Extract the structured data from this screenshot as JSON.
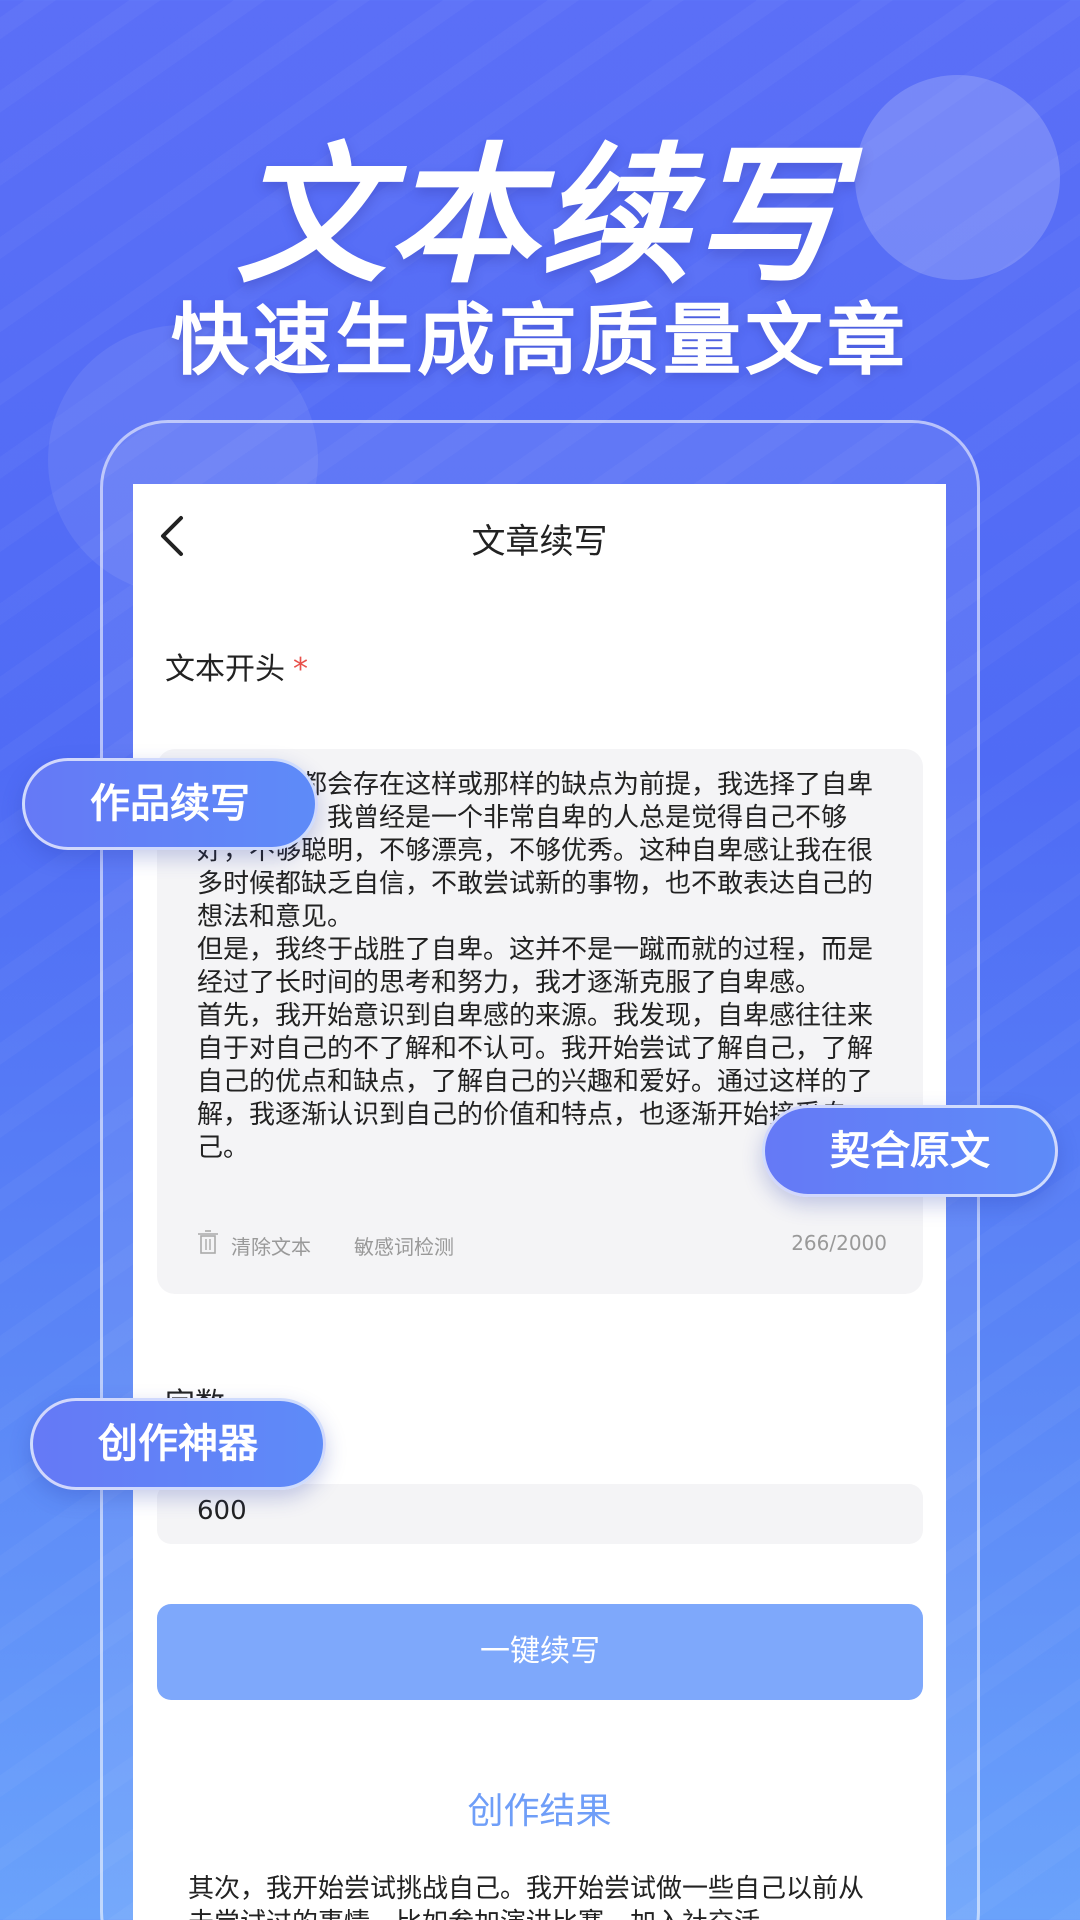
{
  "hero": {
    "title": "文本续写",
    "subtitle": "快速生成高质量文章"
  },
  "nav": {
    "title": "文章续写",
    "back_icon": "chevron-left-icon"
  },
  "text_beginning": {
    "label": "文本开头",
    "required_mark": "*",
    "content": "以每个人都会存在这样或那样的缺点为前提，我选择了自卑这个方面。我曾经是一个非常自卑的人总是觉得自己不够好，不够聪明，不够漂亮，不够优秀。这种自卑感让我在很多时候都缺乏自信，不敢尝试新的事物，也不敢表达自己的想法和意见。\n但是，我终于战胜了自卑。这并不是一蹴而就的过程，而是经过了长时间的思考和努力，我才逐渐克服了自卑感。\n首先，我开始意识到自卑感的来源。我发现，自卑感往往来自于对自己的不了解和不认可。我开始尝试了解自己，了解自己的优点和缺点，了解自己的兴趣和爱好。通过这样的了解，我逐渐认识到自己的价值和特点，也逐渐开始接受自己。",
    "clear_label": "清除文本",
    "sensitive_label": "敏感词检测",
    "char_count": "266/2000",
    "trash_icon": "trash-icon"
  },
  "word_count": {
    "label": "字数",
    "value": "600"
  },
  "submit": {
    "label": "一键续写"
  },
  "result": {
    "title": "创作结果",
    "text": "其次，我开始尝试挑战自己。我开始尝试做一些自己以前从未尝试过的事情，比如参加演讲比赛，加入社交活"
  },
  "tags": {
    "tag1": "作品续写",
    "tag2": "契合原文",
    "tag3": "创作神器"
  },
  "colors": {
    "accent": "#7ea8fb",
    "result_title": "#6f9ef8",
    "required": "#e8504a",
    "background": "#5b6ff7"
  }
}
